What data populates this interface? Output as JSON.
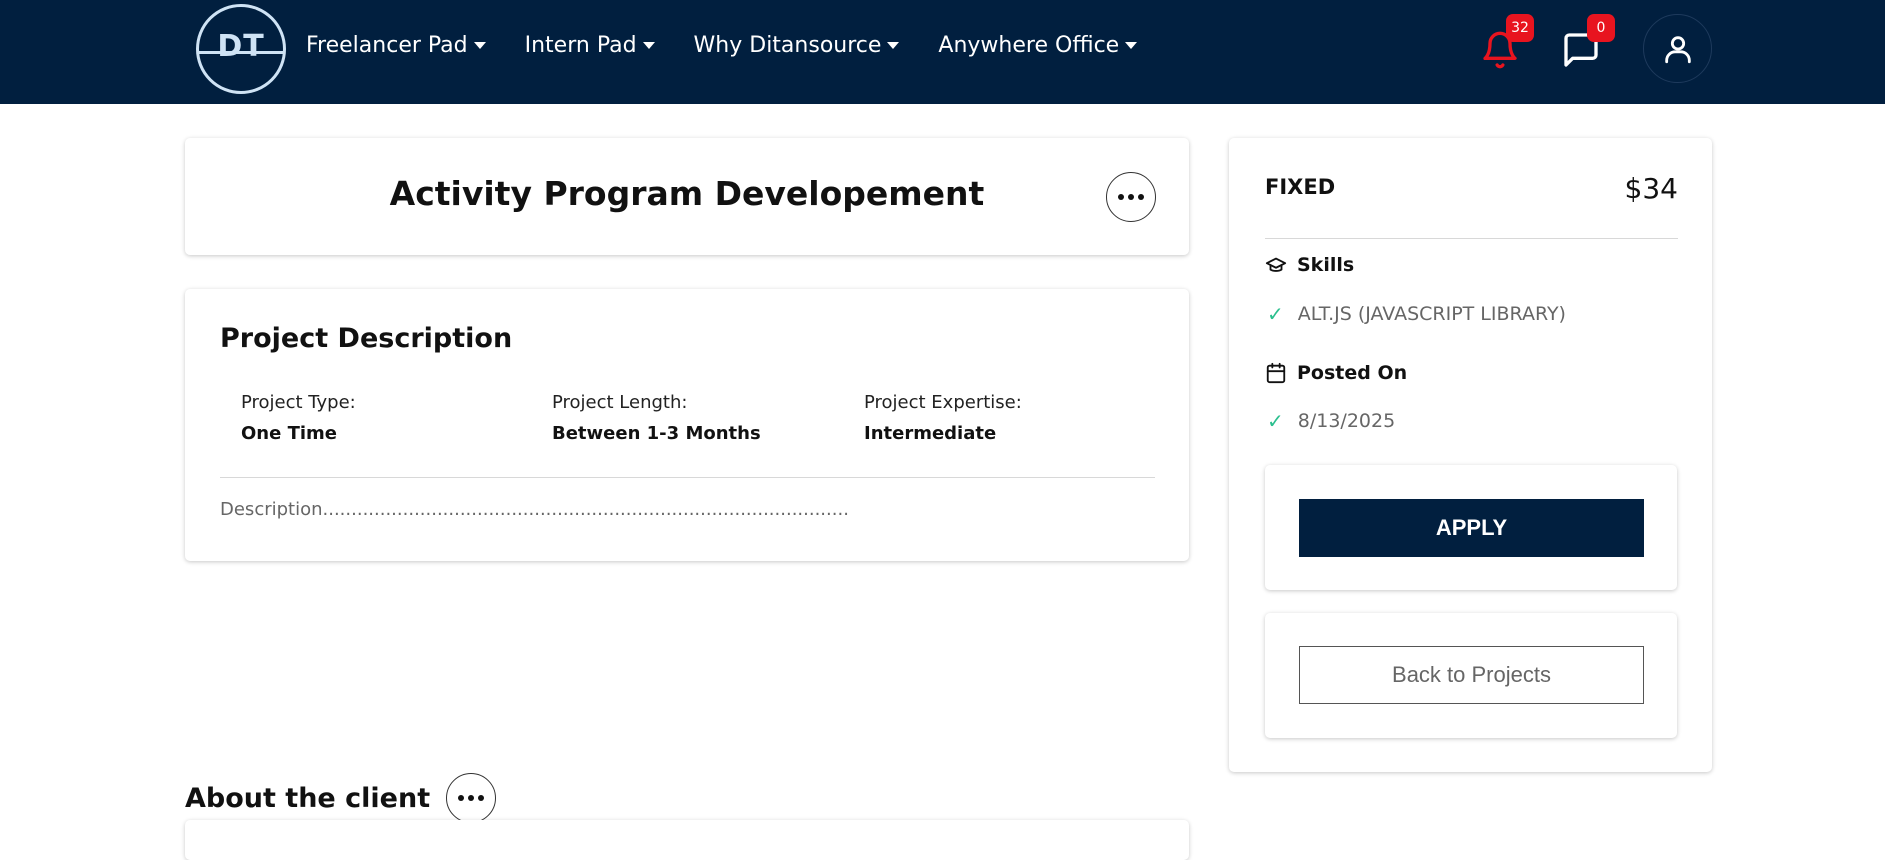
{
  "nav": {
    "logo_text": "DT",
    "links": [
      {
        "label": "Freelancer Pad"
      },
      {
        "label": "Intern Pad"
      },
      {
        "label": "Why Ditansource"
      },
      {
        "label": "Anywhere Office"
      }
    ],
    "notifications_count": "32",
    "messages_count": "0",
    "accent_color": "#011f3f",
    "badge_color": "#e8141f"
  },
  "project": {
    "title": "Activity Program Developement",
    "description_heading": "Project Description",
    "type_label": "Project Type:",
    "type_value": "One Time",
    "length_label": "Project Length:",
    "length_value": "Between 1-3 Months",
    "expertise_label": "Project Expertise:",
    "expertise_value": "Intermediate",
    "description": "Description............................................................................................"
  },
  "client": {
    "heading": "About the client"
  },
  "sidebar": {
    "price_type": "FIXED",
    "price": "$34",
    "skills_heading": "Skills",
    "skill": "ALT.JS (JAVASCRIPT LIBRARY)",
    "posted_heading": "Posted On",
    "posted_date": "8/13/2025",
    "apply_label": "APPLY",
    "back_label": "Back to Projects"
  }
}
